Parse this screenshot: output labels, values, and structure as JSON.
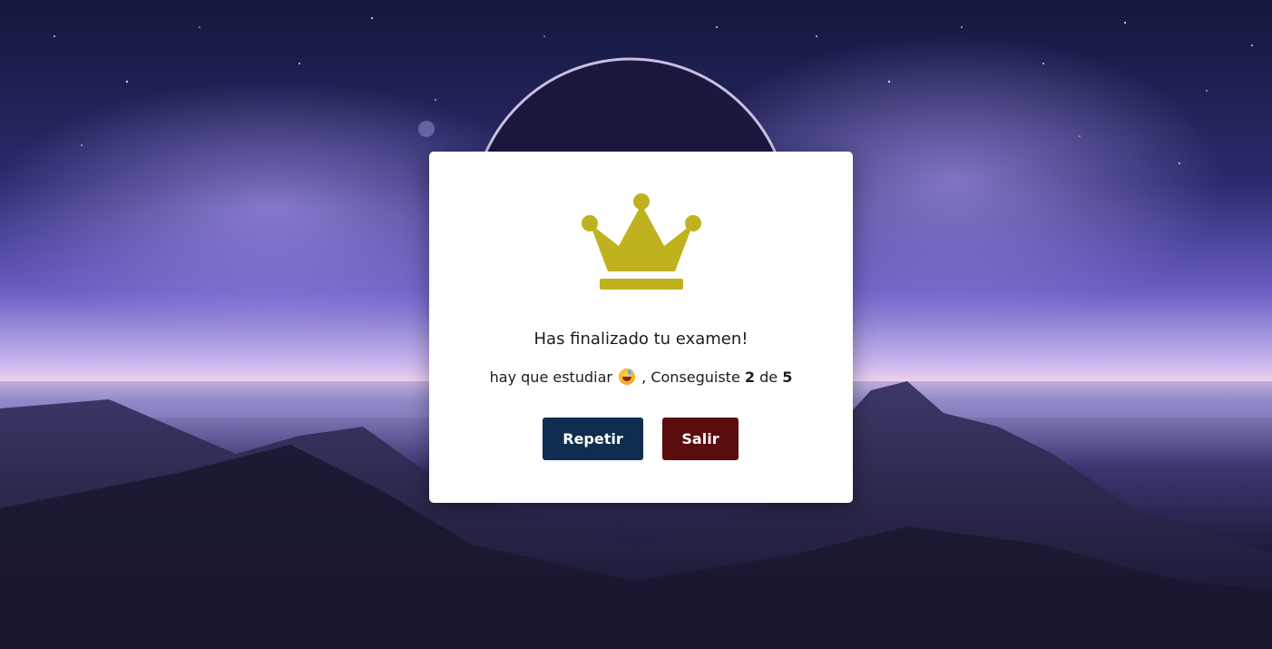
{
  "modal": {
    "icon": "crown-icon",
    "icon_color": "#c0b21e",
    "title": "Has finalizado tu examen!",
    "message_prefix": "hay que estudiar",
    "emoji": "grinning-sweat-emoji",
    "message_mid": ", Conseguiste",
    "score_obtained": "2",
    "score_connector": "de",
    "score_total": "5",
    "buttons": {
      "repeat_label": "Repetir",
      "exit_label": "Salir"
    }
  },
  "colors": {
    "repeat_button": "#0f2d4f",
    "exit_button": "#5b0c0c"
  }
}
